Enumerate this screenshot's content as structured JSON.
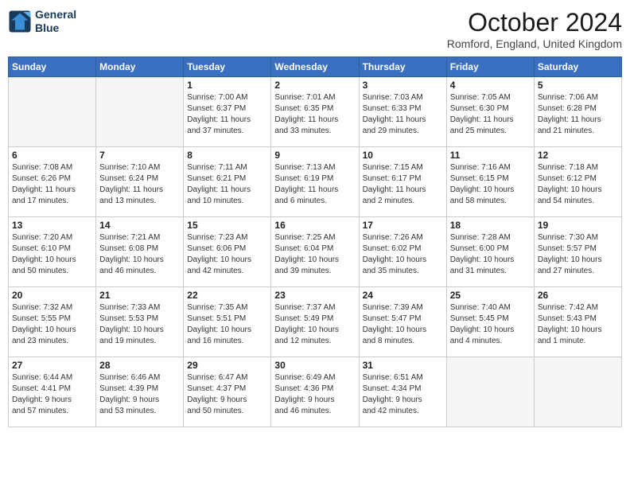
{
  "header": {
    "logo_line1": "General",
    "logo_line2": "Blue",
    "month": "October 2024",
    "location": "Romford, England, United Kingdom"
  },
  "days_of_week": [
    "Sunday",
    "Monday",
    "Tuesday",
    "Wednesday",
    "Thursday",
    "Friday",
    "Saturday"
  ],
  "weeks": [
    [
      {
        "day": "",
        "detail": ""
      },
      {
        "day": "",
        "detail": ""
      },
      {
        "day": "1",
        "detail": "Sunrise: 7:00 AM\nSunset: 6:37 PM\nDaylight: 11 hours\nand 37 minutes."
      },
      {
        "day": "2",
        "detail": "Sunrise: 7:01 AM\nSunset: 6:35 PM\nDaylight: 11 hours\nand 33 minutes."
      },
      {
        "day": "3",
        "detail": "Sunrise: 7:03 AM\nSunset: 6:33 PM\nDaylight: 11 hours\nand 29 minutes."
      },
      {
        "day": "4",
        "detail": "Sunrise: 7:05 AM\nSunset: 6:30 PM\nDaylight: 11 hours\nand 25 minutes."
      },
      {
        "day": "5",
        "detail": "Sunrise: 7:06 AM\nSunset: 6:28 PM\nDaylight: 11 hours\nand 21 minutes."
      }
    ],
    [
      {
        "day": "6",
        "detail": "Sunrise: 7:08 AM\nSunset: 6:26 PM\nDaylight: 11 hours\nand 17 minutes."
      },
      {
        "day": "7",
        "detail": "Sunrise: 7:10 AM\nSunset: 6:24 PM\nDaylight: 11 hours\nand 13 minutes."
      },
      {
        "day": "8",
        "detail": "Sunrise: 7:11 AM\nSunset: 6:21 PM\nDaylight: 11 hours\nand 10 minutes."
      },
      {
        "day": "9",
        "detail": "Sunrise: 7:13 AM\nSunset: 6:19 PM\nDaylight: 11 hours\nand 6 minutes."
      },
      {
        "day": "10",
        "detail": "Sunrise: 7:15 AM\nSunset: 6:17 PM\nDaylight: 11 hours\nand 2 minutes."
      },
      {
        "day": "11",
        "detail": "Sunrise: 7:16 AM\nSunset: 6:15 PM\nDaylight: 10 hours\nand 58 minutes."
      },
      {
        "day": "12",
        "detail": "Sunrise: 7:18 AM\nSunset: 6:12 PM\nDaylight: 10 hours\nand 54 minutes."
      }
    ],
    [
      {
        "day": "13",
        "detail": "Sunrise: 7:20 AM\nSunset: 6:10 PM\nDaylight: 10 hours\nand 50 minutes."
      },
      {
        "day": "14",
        "detail": "Sunrise: 7:21 AM\nSunset: 6:08 PM\nDaylight: 10 hours\nand 46 minutes."
      },
      {
        "day": "15",
        "detail": "Sunrise: 7:23 AM\nSunset: 6:06 PM\nDaylight: 10 hours\nand 42 minutes."
      },
      {
        "day": "16",
        "detail": "Sunrise: 7:25 AM\nSunset: 6:04 PM\nDaylight: 10 hours\nand 39 minutes."
      },
      {
        "day": "17",
        "detail": "Sunrise: 7:26 AM\nSunset: 6:02 PM\nDaylight: 10 hours\nand 35 minutes."
      },
      {
        "day": "18",
        "detail": "Sunrise: 7:28 AM\nSunset: 6:00 PM\nDaylight: 10 hours\nand 31 minutes."
      },
      {
        "day": "19",
        "detail": "Sunrise: 7:30 AM\nSunset: 5:57 PM\nDaylight: 10 hours\nand 27 minutes."
      }
    ],
    [
      {
        "day": "20",
        "detail": "Sunrise: 7:32 AM\nSunset: 5:55 PM\nDaylight: 10 hours\nand 23 minutes."
      },
      {
        "day": "21",
        "detail": "Sunrise: 7:33 AM\nSunset: 5:53 PM\nDaylight: 10 hours\nand 19 minutes."
      },
      {
        "day": "22",
        "detail": "Sunrise: 7:35 AM\nSunset: 5:51 PM\nDaylight: 10 hours\nand 16 minutes."
      },
      {
        "day": "23",
        "detail": "Sunrise: 7:37 AM\nSunset: 5:49 PM\nDaylight: 10 hours\nand 12 minutes."
      },
      {
        "day": "24",
        "detail": "Sunrise: 7:39 AM\nSunset: 5:47 PM\nDaylight: 10 hours\nand 8 minutes."
      },
      {
        "day": "25",
        "detail": "Sunrise: 7:40 AM\nSunset: 5:45 PM\nDaylight: 10 hours\nand 4 minutes."
      },
      {
        "day": "26",
        "detail": "Sunrise: 7:42 AM\nSunset: 5:43 PM\nDaylight: 10 hours\nand 1 minute."
      }
    ],
    [
      {
        "day": "27",
        "detail": "Sunrise: 6:44 AM\nSunset: 4:41 PM\nDaylight: 9 hours\nand 57 minutes."
      },
      {
        "day": "28",
        "detail": "Sunrise: 6:46 AM\nSunset: 4:39 PM\nDaylight: 9 hours\nand 53 minutes."
      },
      {
        "day": "29",
        "detail": "Sunrise: 6:47 AM\nSunset: 4:37 PM\nDaylight: 9 hours\nand 50 minutes."
      },
      {
        "day": "30",
        "detail": "Sunrise: 6:49 AM\nSunset: 4:36 PM\nDaylight: 9 hours\nand 46 minutes."
      },
      {
        "day": "31",
        "detail": "Sunrise: 6:51 AM\nSunset: 4:34 PM\nDaylight: 9 hours\nand 42 minutes."
      },
      {
        "day": "",
        "detail": ""
      },
      {
        "day": "",
        "detail": ""
      }
    ]
  ]
}
